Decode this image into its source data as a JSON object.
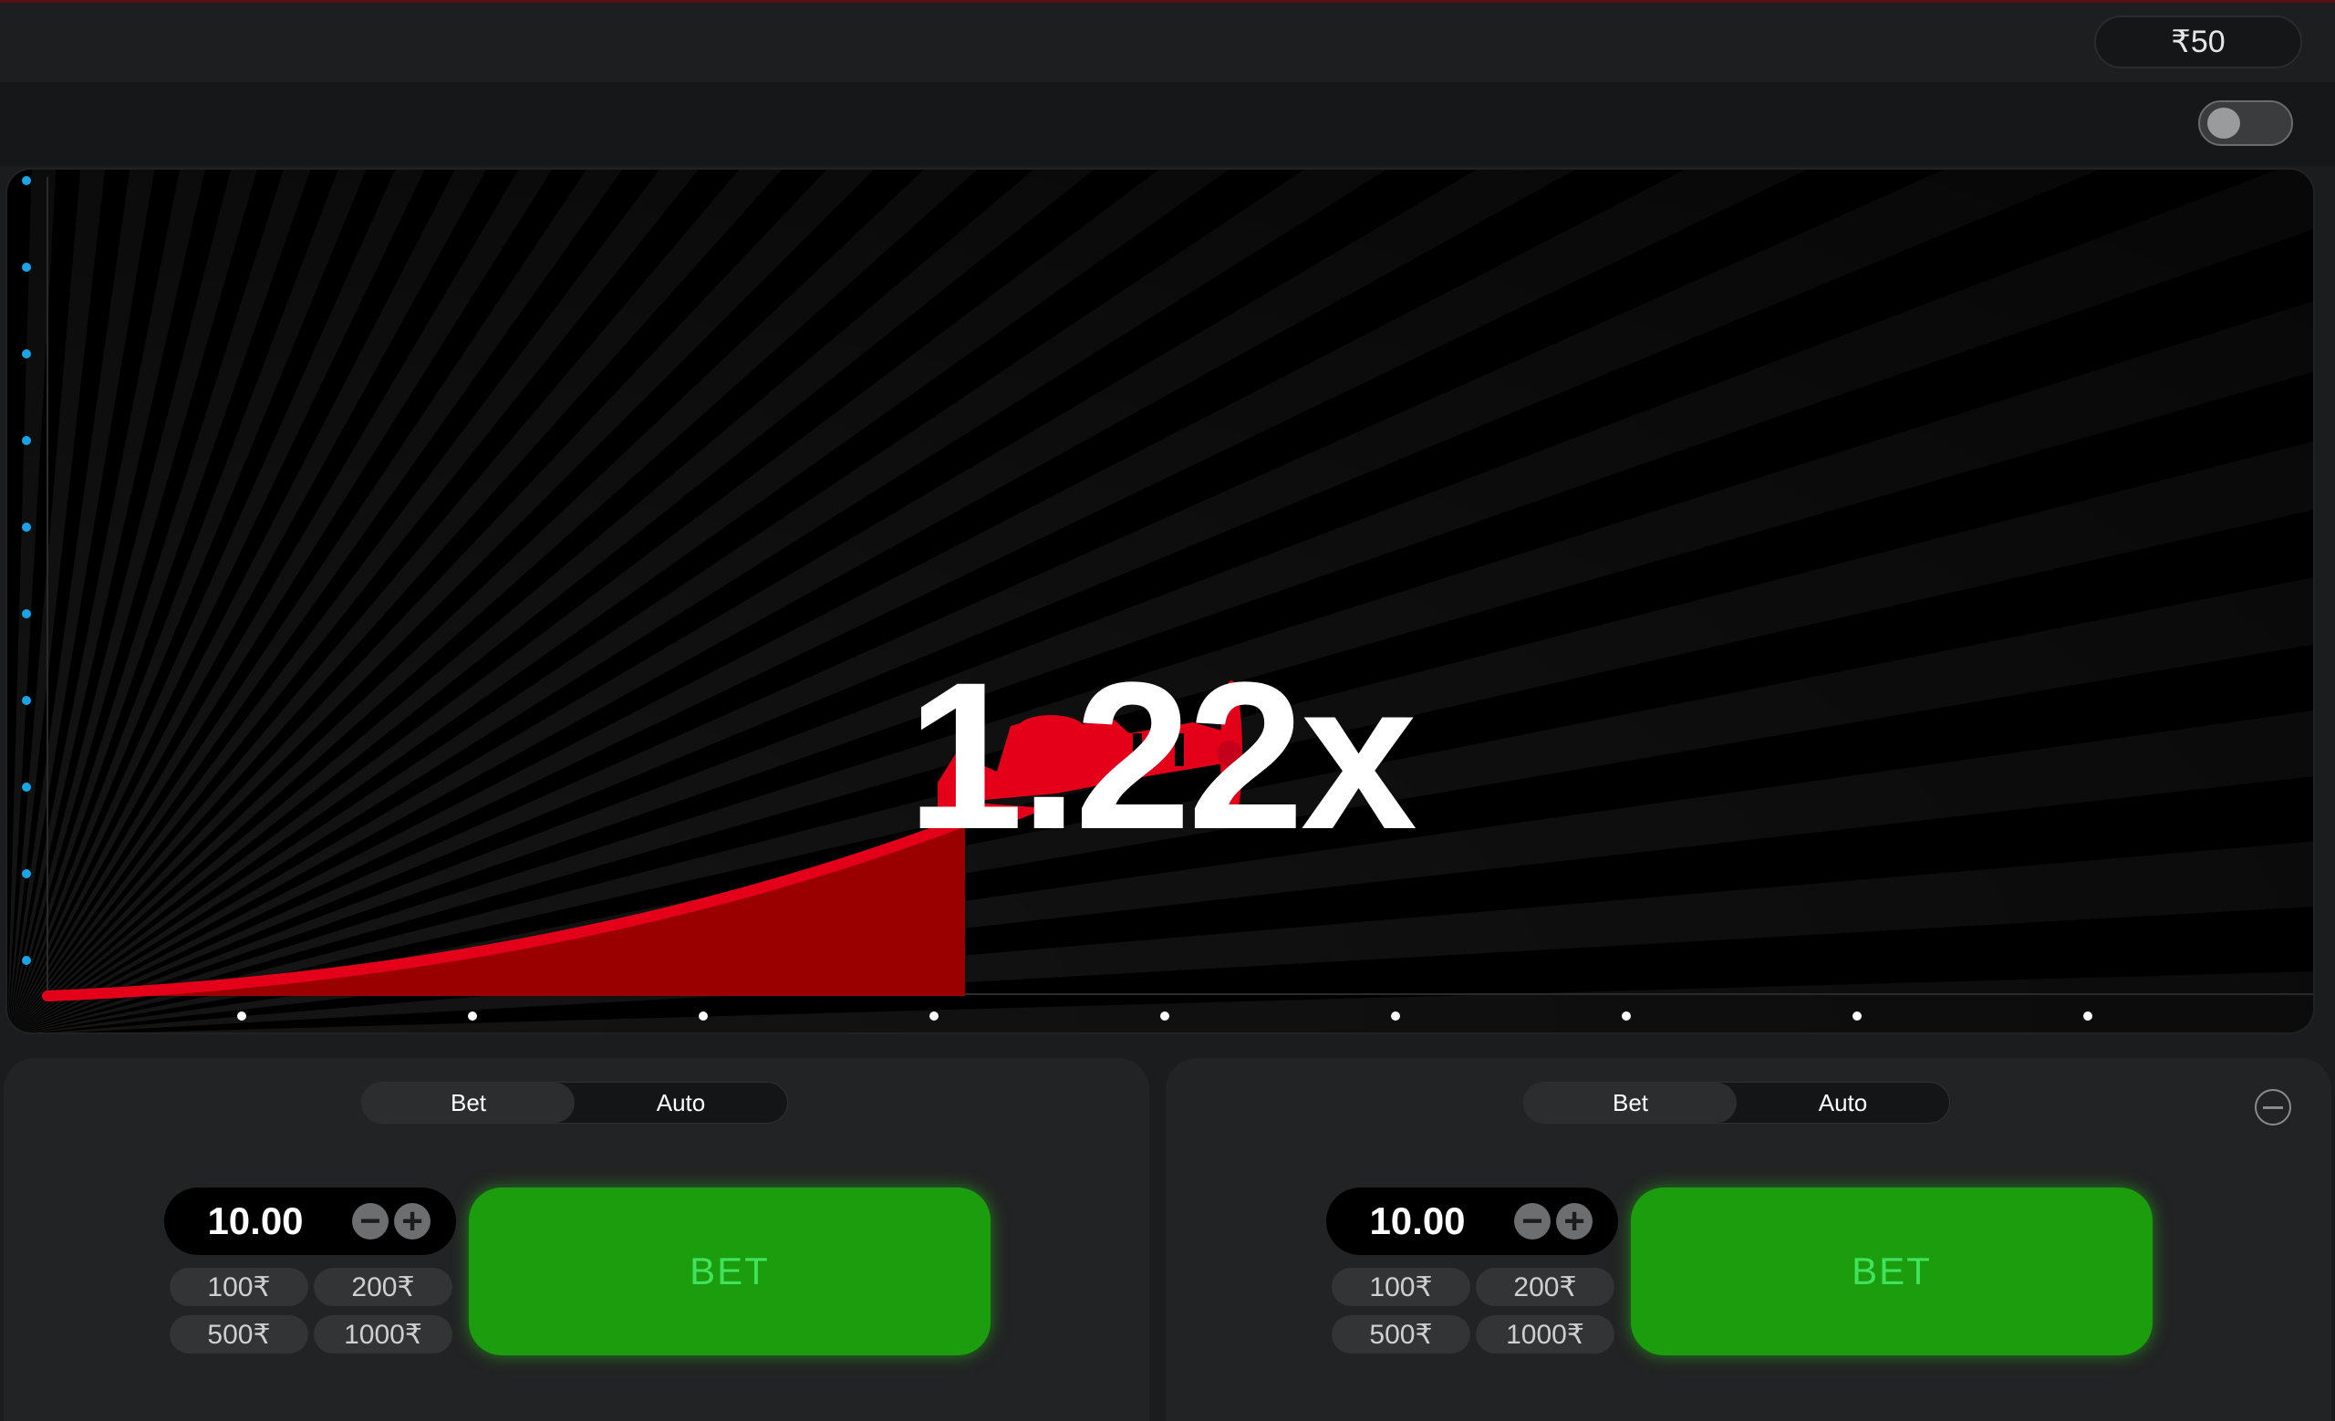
{
  "header": {
    "balance": "₹50"
  },
  "game": {
    "multiplier": "1.22x"
  },
  "colors": {
    "accent_red": "#e5001a",
    "bet_green": "#1c9d0e",
    "bet_text": "#3fe35e",
    "axis_dot_blue": "#1aa3e6"
  },
  "panels": [
    {
      "tabs": [
        {
          "label": "Bet"
        },
        {
          "label": "Auto"
        }
      ],
      "stake": "10.00",
      "quick_amounts": [
        "100₹",
        "200₹",
        "500₹",
        "1000₹"
      ],
      "bet_label": "BET"
    },
    {
      "tabs": [
        {
          "label": "Bet"
        },
        {
          "label": "Auto"
        }
      ],
      "stake": "10.00",
      "quick_amounts": [
        "100₹",
        "200₹",
        "500₹",
        "1000₹"
      ],
      "bet_label": "BET"
    }
  ],
  "icons": {
    "minus": "minus-icon",
    "plus": "plus-icon",
    "plane": "airplane-icon",
    "sound": "sound-toggle-icon"
  }
}
